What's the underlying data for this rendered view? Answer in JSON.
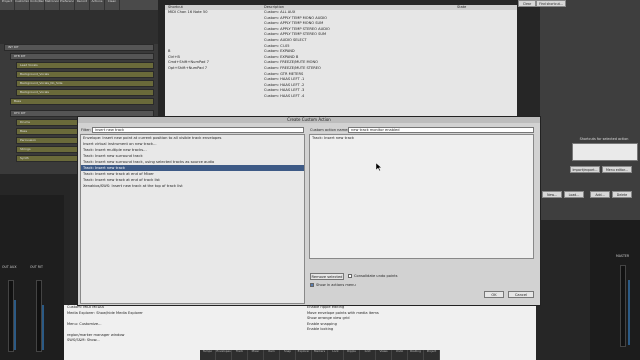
{
  "toolbar": {
    "buttons": [
      "Project",
      "Customize",
      "Undo/Redo",
      "Metronome",
      "Preferences",
      "Record",
      "Actions",
      "Clean"
    ]
  },
  "tracks": [
    {
      "label": "INT RIT"
    },
    {
      "label": "RTB RIT"
    },
    {
      "label": "Lead Vocals"
    },
    {
      "label": "Background_Vocals"
    },
    {
      "label": "Background_Vocals_No_Side"
    },
    {
      "label": "Background_Vocals"
    },
    {
      "label": "Bass"
    },
    {
      "label": "RFX RIT"
    },
    {
      "label": "Drums"
    },
    {
      "label": "Bass"
    },
    {
      "label": "Percussion"
    },
    {
      "label": "Strings"
    },
    {
      "label": "Synth"
    }
  ],
  "backlist": {
    "headers": [
      "Shortcut",
      "Description",
      "State"
    ],
    "rows": [
      {
        "sc": "MIDI Chan 16 Note 50",
        "de": "Custom: ALL AUX"
      },
      {
        "sc": "",
        "de": "Custom: APPLY TEMP MONO AUDIO"
      },
      {
        "sc": "",
        "de": "Custom: APPLY TEMP MONO SUM"
      },
      {
        "sc": "",
        "de": "Custom: APPLY TEMP STEREO AUDIO"
      },
      {
        "sc": "",
        "de": "Custom: APPLY TEMP STEREO SUM"
      },
      {
        "sc": "",
        "de": "Custom: AUDIO SELECT"
      },
      {
        "sc": "",
        "de": "Custom: CI-05"
      },
      {
        "sc": "B",
        "de": "Custom: EXPAND"
      },
      {
        "sc": "Ctrl+B",
        "de": "Custom: EXPAND B"
      },
      {
        "sc": "Cmd+Shift+NumPad 7",
        "de": "Custom: FREEZE/MUTE MONO"
      },
      {
        "sc": "Opt+Shift+NumPad 7",
        "de": "Custom: FREEZE/MUTE STEREO"
      },
      {
        "sc": "",
        "de": "Custom: GTR METERS"
      },
      {
        "sc": "",
        "de": "Custom: HAAS LEFT .1"
      },
      {
        "sc": "",
        "de": "Custom: HAAS LEFT .2"
      },
      {
        "sc": "",
        "de": "Custom: HAAS LEFT .3"
      },
      {
        "sc": "",
        "de": "Custom: HAAS LEFT .4"
      }
    ]
  },
  "right_panel": {
    "clear": "Clear",
    "find_shortcut": "Find shortcut...",
    "shortcuts_label": "Shortcuts for selected action",
    "import_export": "Import/export...",
    "menu_editor": "Menu editor...",
    "new": "New...",
    "load": "Load...",
    "add": "Add...",
    "delete": "Delete"
  },
  "modal": {
    "title": "Create Custom Action",
    "filter_label": "Filter:",
    "filter_value": "insert new track",
    "name_label": "Custom action name:",
    "name_value": "new track monitor enabled",
    "left_items": [
      {
        "text": "Envelope: Insert new point at current position to all visible track envelopes",
        "selected": false
      },
      {
        "text": "Insert virtual instrument on new track...",
        "selected": false
      },
      {
        "text": "Track: Insert multiple new tracks...",
        "selected": false
      },
      {
        "text": "Track: Insert new surround track",
        "selected": false
      },
      {
        "text": "Track: Insert new surround track, using selected tracks as source audio",
        "selected": false
      },
      {
        "text": "Track: Insert new track",
        "selected": true
      },
      {
        "text": "Track: Insert new track at end of Mixer",
        "selected": false
      },
      {
        "text": "Track: Insert new track at end of track list",
        "selected": false
      },
      {
        "text": "Xenakios/SWS: Insert new track at the top of track list",
        "selected": false
      }
    ],
    "right_items": [
      "Track: Insert new track"
    ],
    "remove_selected": "Remove selected",
    "consolidate": "Consolidate undo points",
    "show_in_actions": "Show in actions menu",
    "ok": "OK",
    "cancel": "Cancel"
  },
  "bottom_list": {
    "left": [
      "Custom: MIDI MEDIA",
      "Media Explorer: Show/hide Media Explorer",
      "",
      "Menu: Customize...",
      "",
      "region/marker manager window",
      "SWS/S&M: Show..."
    ],
    "right": [
      "Enable ripple editing",
      "Move envelope points with media items",
      "Show arrange view grid",
      "Enable snapping",
      "Enable locking"
    ]
  },
  "bottom_bar": [
    "Tempo",
    "Envelopes",
    "Track",
    "Mixer",
    "Item",
    "Snap",
    "Explorer",
    "Markers",
    "Lock",
    "Ripple",
    "Grid",
    "Views",
    "Undo",
    "Routing",
    "Project"
  ],
  "mixer_labels": {
    "out_left": "OUT AUX",
    "out_right": "OUT RIT",
    "master": "MASTER"
  }
}
